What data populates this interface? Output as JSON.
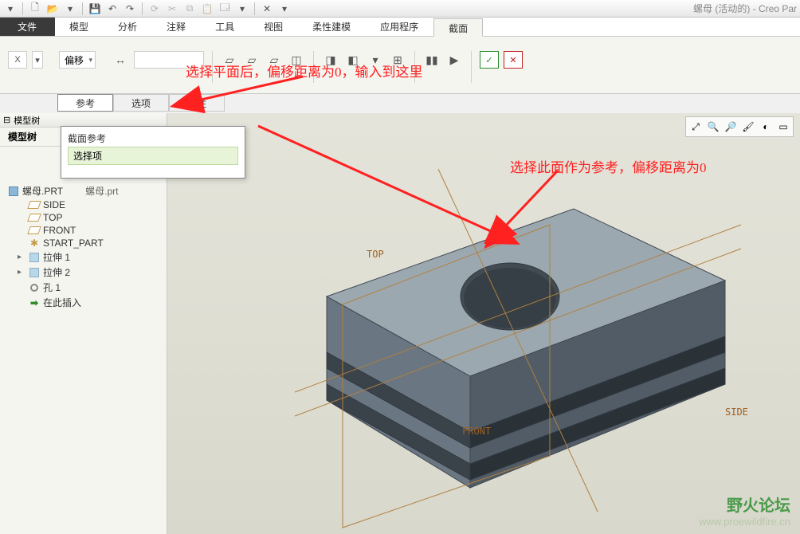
{
  "title": "螺母 (活动的) - Creo Par",
  "ribbon": {
    "tabs": [
      "文件",
      "模型",
      "分析",
      "注释",
      "工具",
      "视图",
      "柔性建模",
      "应用程序",
      "截面"
    ],
    "active": "截面",
    "x_label": "X",
    "offset_label": "偏移",
    "dim_icon": "↔"
  },
  "subtabs": {
    "items": [
      "参考",
      "选项",
      "属性"
    ],
    "active": "参考"
  },
  "popup": {
    "title": "截面参考",
    "value": "选择项"
  },
  "panel": {
    "header": "模型树",
    "tab": "模型树"
  },
  "tree": {
    "root": "螺母.PRT",
    "rootTab": "螺母.prt",
    "items": [
      {
        "icon": "datum",
        "label": "SIDE"
      },
      {
        "icon": "datum",
        "label": "TOP"
      },
      {
        "icon": "datum",
        "label": "FRONT"
      },
      {
        "icon": "star",
        "label": "START_PART"
      },
      {
        "icon": "ext",
        "label": "拉伸 1",
        "exp": "▸"
      },
      {
        "icon": "ext",
        "label": "拉伸 2",
        "exp": "▸"
      },
      {
        "icon": "hole",
        "label": "孔 1"
      },
      {
        "icon": "arrow",
        "label": "在此插入"
      }
    ]
  },
  "annotations": {
    "a1": "选择平面后，偏移距离为0，输入到这里",
    "a2": "选择此面作为参考，偏移距离为0"
  },
  "datums": {
    "top": "TOP",
    "front": "FRONT",
    "side": "SIDE"
  },
  "watermark": {
    "line1": "野火论坛",
    "line2": "www.proewildfire.cn"
  }
}
